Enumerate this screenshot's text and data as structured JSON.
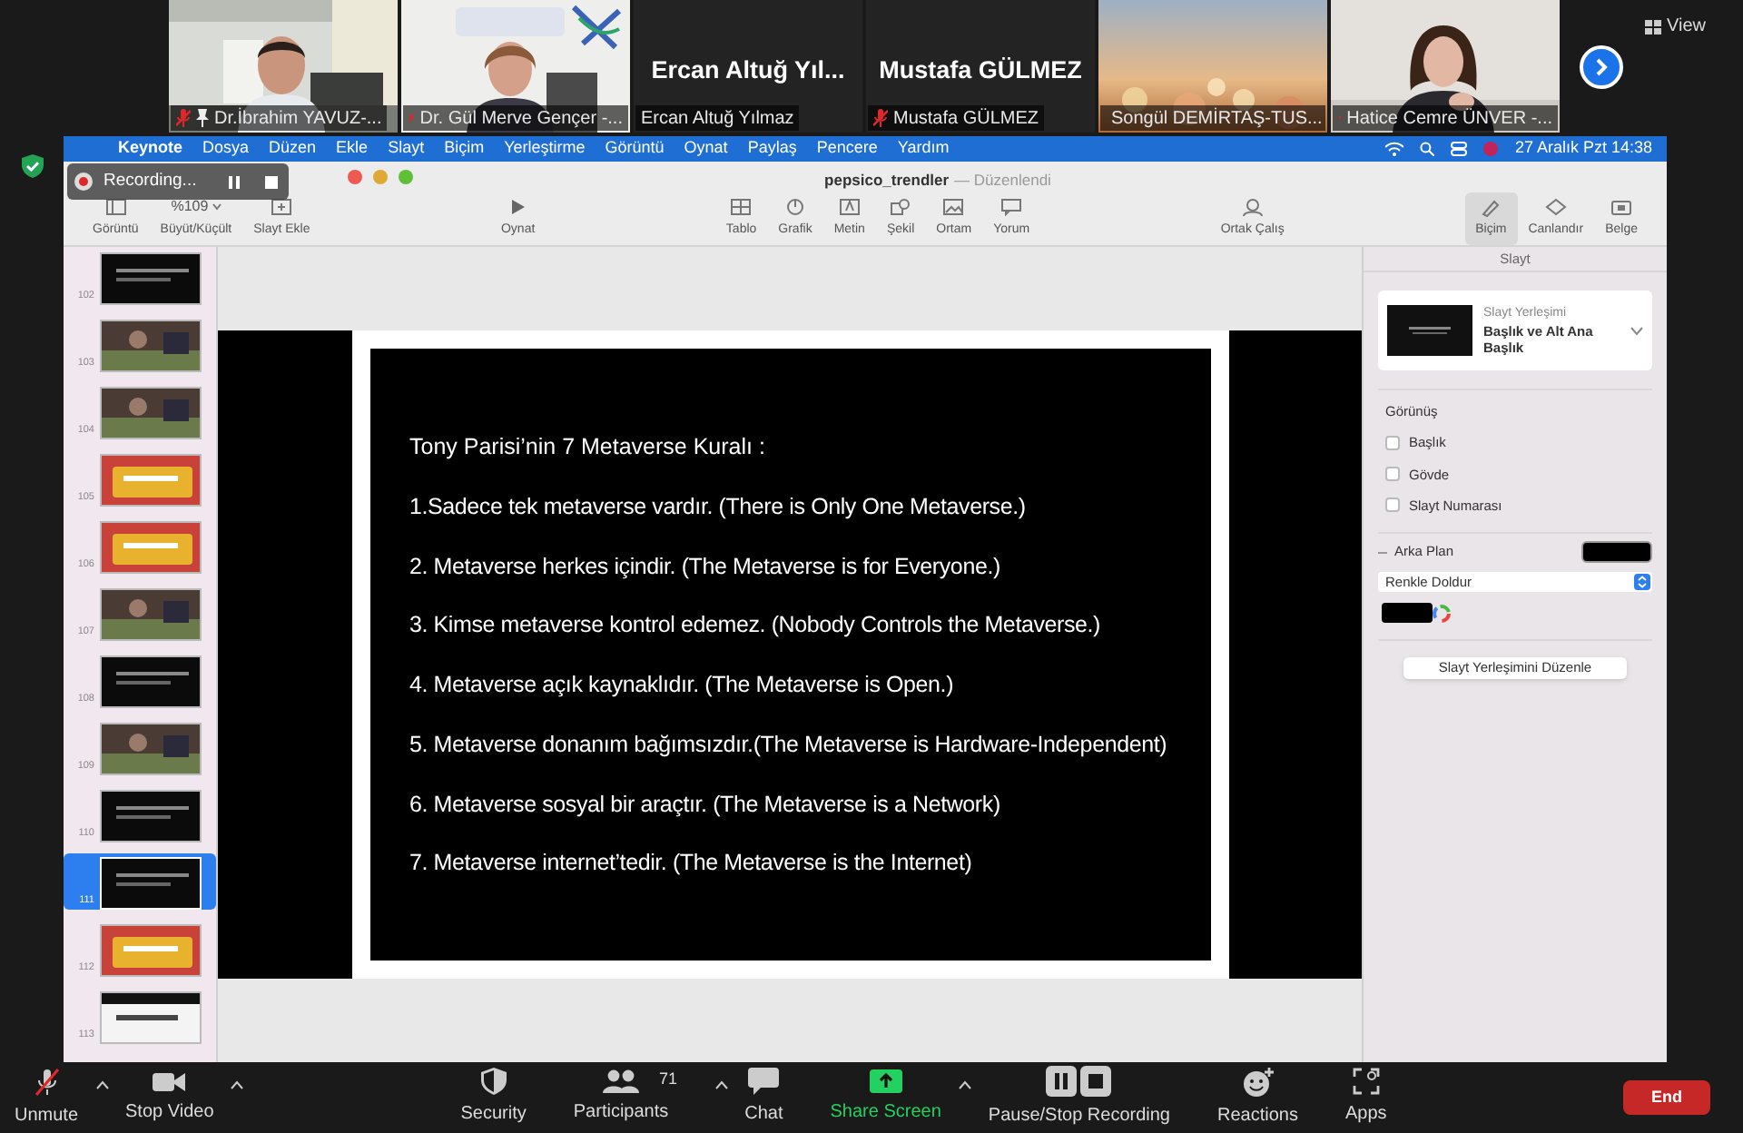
{
  "participants": [
    {
      "kind": "video",
      "name": "Dr.İbrahim YAVUZ-...",
      "muted": true,
      "pinned": true
    },
    {
      "kind": "video",
      "name": "Dr. Gül Merve Gençer -...",
      "muted": true,
      "pinned": false
    },
    {
      "kind": "name",
      "display_name": "Ercan Altuğ Yıl...",
      "name": "Ercan Altuğ Yılmaz",
      "muted": false,
      "pinned": false
    },
    {
      "kind": "name",
      "display_name": "Mustafa GÜLMEZ",
      "name": "Mustafa GÜLMEZ",
      "muted": true,
      "pinned": false
    },
    {
      "kind": "video",
      "name": "Songül DEMİRTAŞ-TUS...",
      "muted": true,
      "pinned": false
    },
    {
      "kind": "video",
      "name": "Hatice Cemre ÜNVER -...",
      "muted": true,
      "pinned": false
    }
  ],
  "view_button": "View",
  "recording": {
    "label": "Recording..."
  },
  "menu": [
    "Keynote",
    "Dosya",
    "Düzen",
    "Ekle",
    "Slayt",
    "Biçim",
    "Yerleştirme",
    "Görüntü",
    "Oynat",
    "Paylaş",
    "Pencere",
    "Yardım"
  ],
  "clock": "27 Aralık Pzt 14:38",
  "document": {
    "title": "pepsico_trendler",
    "status": "— Düzenlendi"
  },
  "toolbar": [
    {
      "kind": "icon",
      "label": "Görüntü",
      "selected": false
    },
    {
      "kind": "zoom",
      "value": "%109",
      "label": "Büyüt/Küçült",
      "selected": false
    },
    {
      "kind": "icon",
      "label": "Slayt Ekle",
      "selected": false
    },
    {
      "kind": "spacer"
    },
    {
      "kind": "icon",
      "label": "Oynat",
      "selected": false
    },
    {
      "kind": "spacer"
    },
    {
      "kind": "icon",
      "label": "Tablo",
      "selected": false
    },
    {
      "kind": "icon",
      "label": "Grafik",
      "selected": false
    },
    {
      "kind": "icon",
      "label": "Metin",
      "selected": false
    },
    {
      "kind": "icon",
      "label": "Şekil",
      "selected": false
    },
    {
      "kind": "icon",
      "label": "Ortam",
      "selected": false
    },
    {
      "kind": "icon",
      "label": "Yorum",
      "selected": false
    },
    {
      "kind": "spacer"
    },
    {
      "kind": "icon",
      "label": "Ortak Çalış",
      "selected": false
    },
    {
      "kind": "spacer"
    },
    {
      "kind": "icon",
      "label": "Biçim",
      "selected": true
    },
    {
      "kind": "icon",
      "label": "Canlandır",
      "selected": false
    },
    {
      "kind": "icon",
      "label": "Belge",
      "selected": false
    }
  ],
  "slides": [
    {
      "number": "102",
      "selected": false,
      "kind": "dark"
    },
    {
      "number": "103",
      "selected": false
    },
    {
      "number": "104",
      "selected": false
    },
    {
      "number": "105",
      "selected": false,
      "kind": "color"
    },
    {
      "number": "106",
      "selected": false,
      "kind": "color"
    },
    {
      "number": "107",
      "selected": false
    },
    {
      "number": "108",
      "selected": false,
      "kind": "dark"
    },
    {
      "number": "109",
      "selected": false
    },
    {
      "number": "110",
      "selected": false,
      "kind": "dark"
    },
    {
      "number": "111",
      "selected": true,
      "kind": "dark"
    },
    {
      "number": "112",
      "selected": false,
      "kind": "color"
    },
    {
      "number": "113",
      "selected": false,
      "kind": "light"
    }
  ],
  "slide": {
    "title": "Tony Parisi’nin 7 Metaverse Kuralı :",
    "lines": [
      "1.Sadece tek metaverse vardır. (There is Only One Metaverse.)",
      "2. Metaverse herkes içindir. (The Metaverse is for Everyone.)",
      "3. Kimse metaverse kontrol edemez. (Nobody Controls the Metaverse.)",
      "4. Metaverse açık kaynaklıdır. (The Metaverse is Open.)",
      "5. Metaverse donanım bağımsızdır.(The Metaverse is Hardware-Independent)",
      "6. Metaverse sosyal bir araçtır. (The Metaverse is a Network)",
      "7. Metaverse internet’tedir. (The Metaverse is the Internet)"
    ]
  },
  "inspector": {
    "tab": "Slayt",
    "layout_caption": "Slayt Yerleşimi",
    "layout_name": "Başlık ve Alt Ana Başlık",
    "appearance_heading": "Görünüş",
    "options": [
      {
        "label": "Başlık",
        "checked": false
      },
      {
        "label": "Gövde",
        "checked": false
      },
      {
        "label": "Slayt Numarası",
        "checked": false
      }
    ],
    "background_heading": "Arka Plan",
    "fill_type": "Renkle Doldur",
    "edit_button": "Slayt Yerleşimini Düzenle"
  },
  "controls": [
    {
      "kind": "mic",
      "label": "Unmute",
      "muted": true,
      "caret": true
    },
    {
      "kind": "video",
      "label": "Stop Video",
      "caret": true
    },
    {
      "kind": "gap"
    },
    {
      "kind": "security",
      "label": "Security",
      "caret": false
    },
    {
      "kind": "participants",
      "label": "Participants",
      "count": "71",
      "caret": true
    },
    {
      "kind": "chat",
      "label": "Chat",
      "caret": false
    },
    {
      "kind": "share",
      "label": "Share Screen",
      "caret": true
    },
    {
      "kind": "recording",
      "label": "Pause/Stop Recording",
      "caret": false
    },
    {
      "kind": "reactions",
      "label": "Reactions",
      "caret": false
    },
    {
      "kind": "apps",
      "label": "Apps",
      "caret": false
    },
    {
      "kind": "gap"
    }
  ],
  "end_button": "End"
}
